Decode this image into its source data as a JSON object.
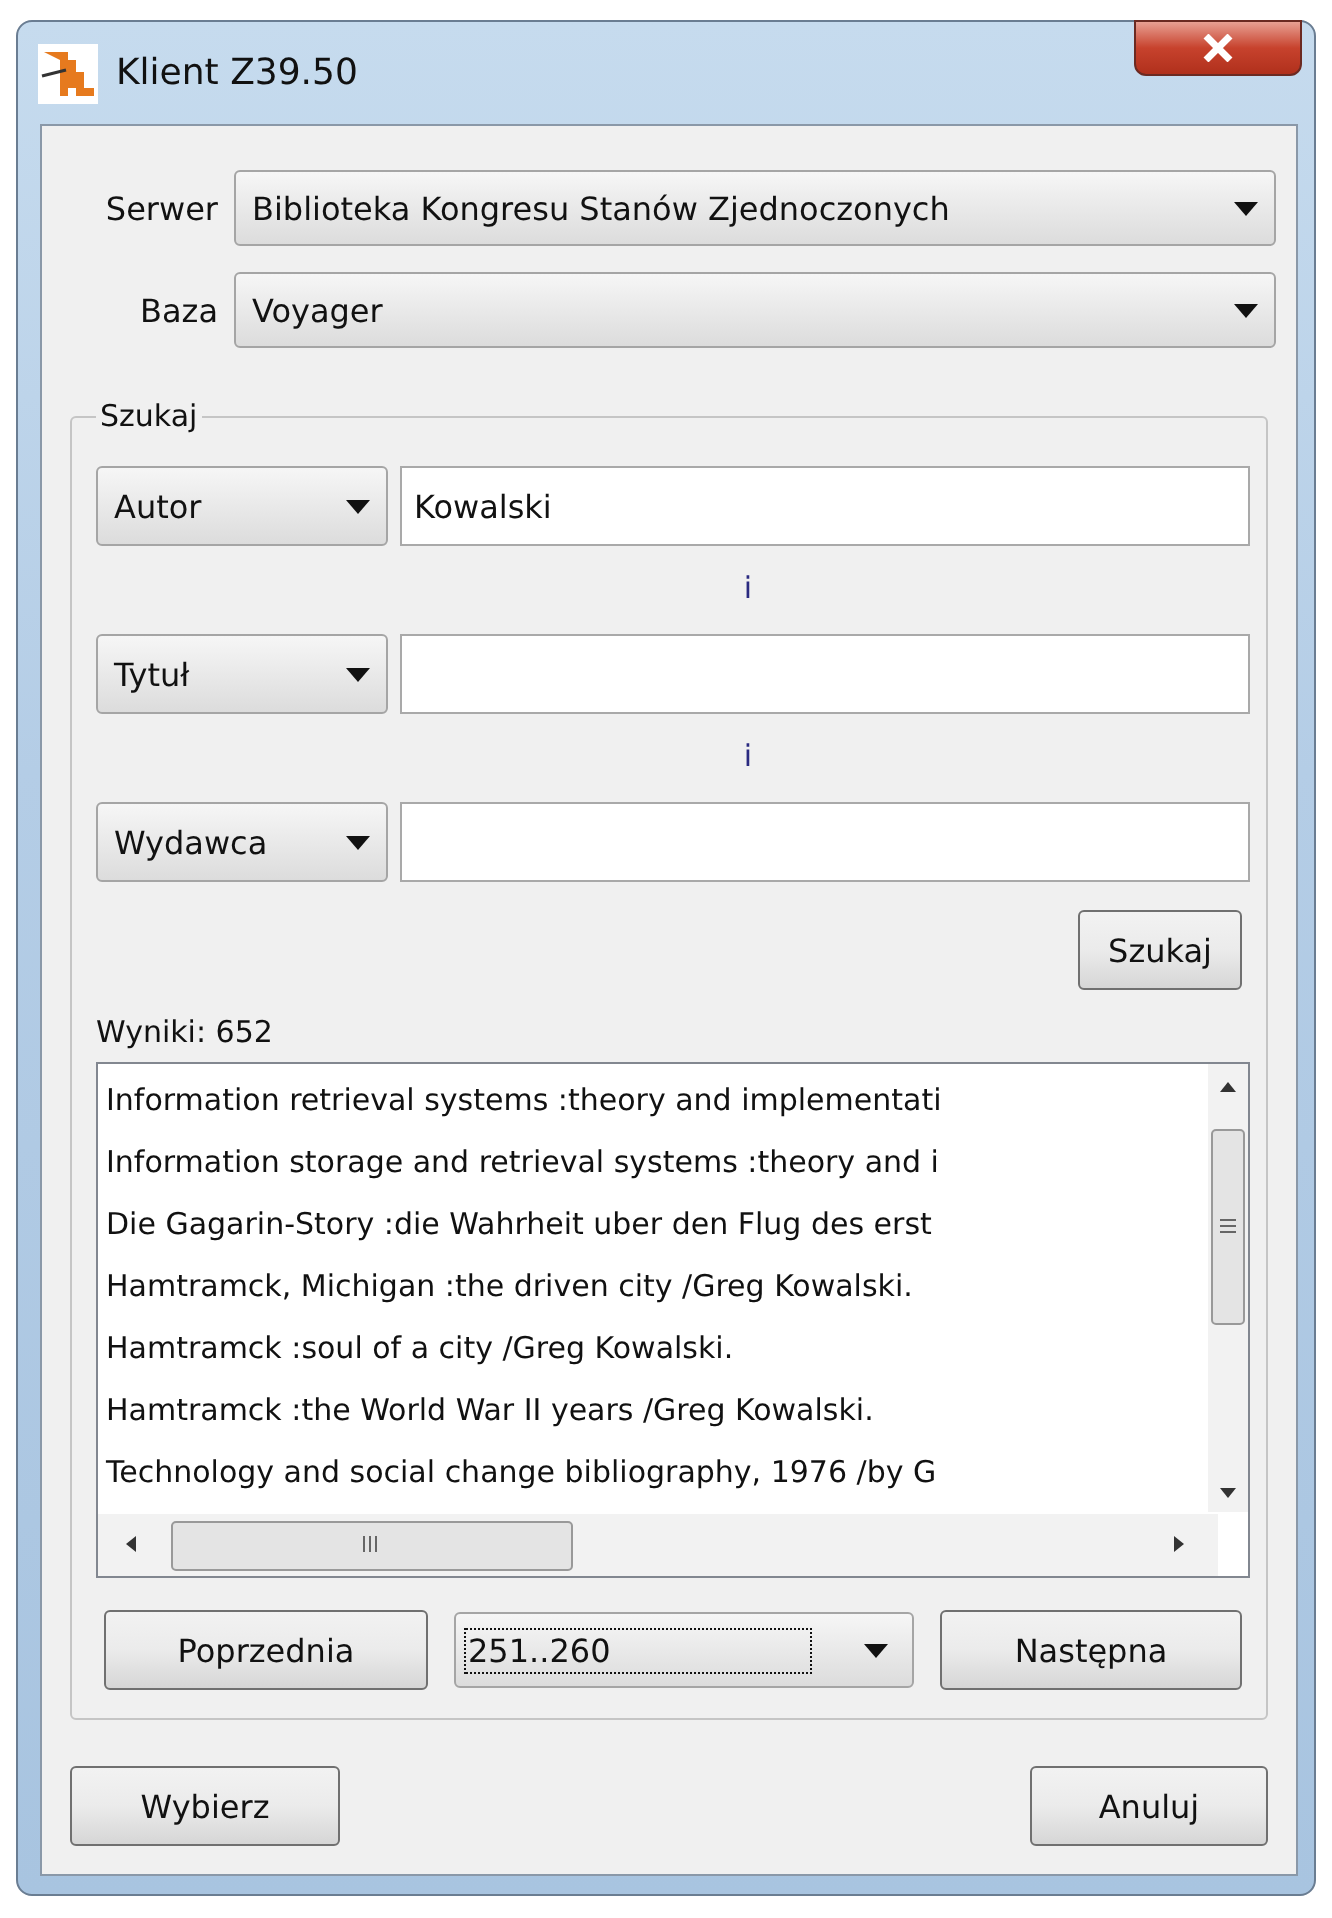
{
  "window": {
    "title": "Klient Z39.50"
  },
  "server": {
    "label": "Serwer",
    "value": "Biblioteka Kongresu Stanów Zjednoczonych"
  },
  "database": {
    "label": "Baza",
    "value": "Voyager"
  },
  "search": {
    "title": "Szukaj",
    "criteria": [
      {
        "field": "Autor",
        "value": "Kowalski"
      },
      {
        "field": "Tytuł"
      },
      {
        "field": "Wydawca"
      }
    ],
    "connectors": [
      "i",
      "i"
    ],
    "button": "Szukaj"
  },
  "results": {
    "label": "Wyniki: 652",
    "items": [
      "Information retrieval systems :theory and implementati",
      "Information storage and retrieval systems :theory and i",
      "Die Gagarin-Story :die Wahrheit uber den Flug des erst",
      "Hamtramck, Michigan :the driven city /Greg Kowalski.",
      "Hamtramck :soul of a city /Greg Kowalski.",
      "Hamtramck :the World War II years /Greg Kowalski.",
      "Technology and social change bibliography, 1976 /by G"
    ]
  },
  "pager": {
    "previous": "Poprzednia",
    "range": "251..260",
    "range_focused": true,
    "next": "Następna"
  },
  "buttons": [
    "Wybierz",
    "Anuluj"
  ]
}
